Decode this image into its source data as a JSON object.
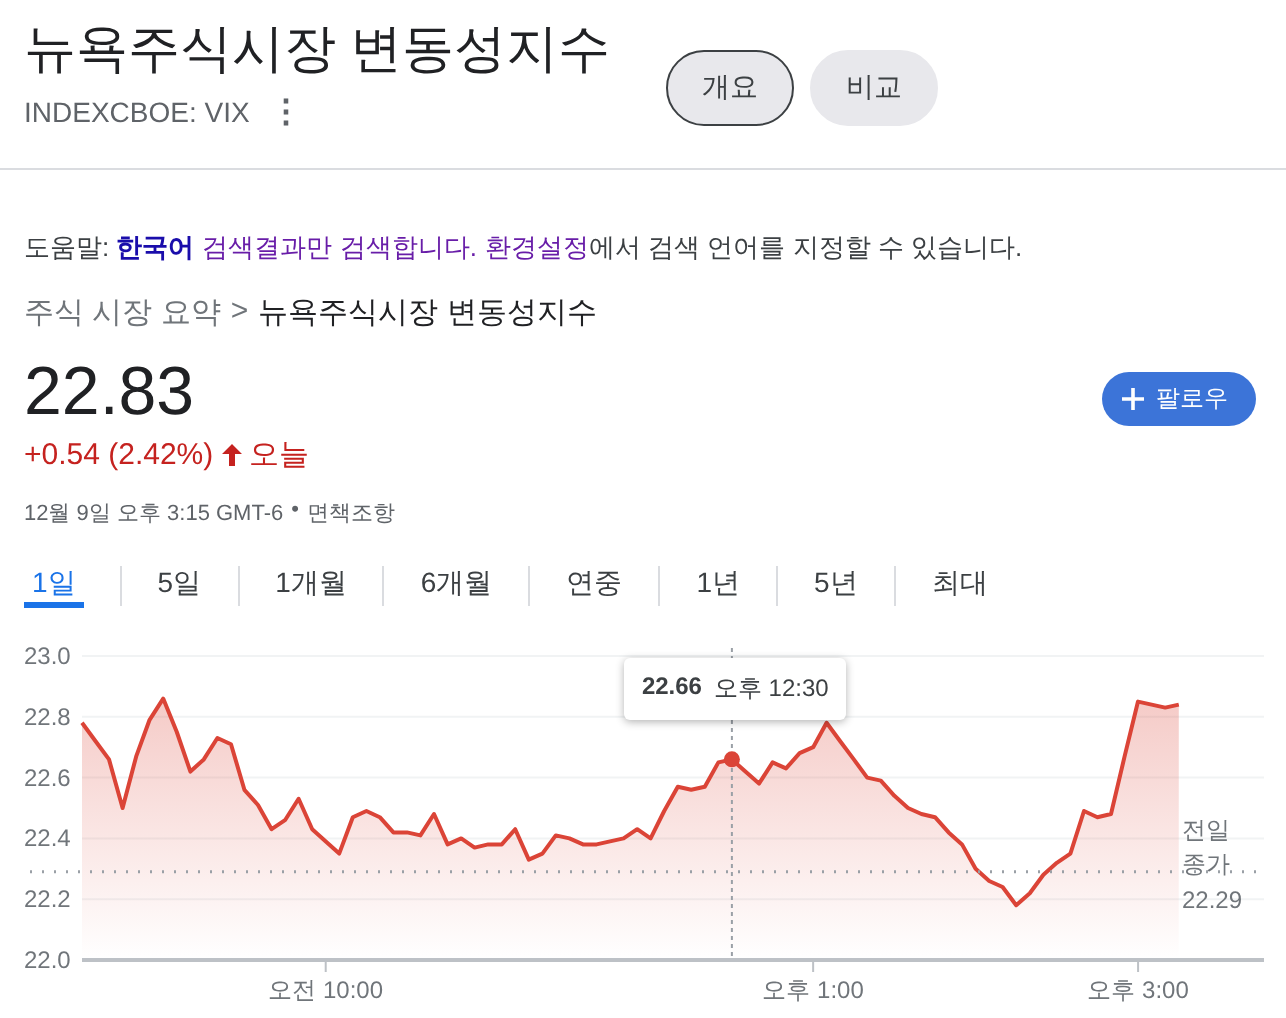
{
  "header": {
    "title": "뉴욕주식시장 변동성지수",
    "ticker": "INDEXCBOE: VIX",
    "menu_icon": "⋮",
    "buttons": [
      {
        "label": "개요",
        "selected": true
      },
      {
        "label": "비교",
        "selected": false
      }
    ]
  },
  "help": [
    {
      "text": "도움말: ",
      "kind": "plain"
    },
    {
      "text": "한국어",
      "kind": "strong-link"
    },
    {
      "text": "검색결과만 검색합니다.",
      "kind": "link"
    },
    {
      "text": "환경설정",
      "kind": "link"
    },
    {
      "text": "에서 검색 언어를 지정할 수 있습니다.",
      "kind": "plain"
    }
  ],
  "breadcrumb": {
    "parent": "주식 시장 요약",
    "separator": ">",
    "current": "뉴욕주식시장 변동성지수"
  },
  "quote": {
    "price": "22.83",
    "change": "+0.54 (2.42%)",
    "period": "오늘",
    "timestamp": "12월 9일 오후 3:15 GMT-6",
    "separator": "•",
    "disclaimer": "면책조항",
    "follow_button": "팔로우"
  },
  "tabs": [
    {
      "label": "1일",
      "selected": true
    },
    {
      "label": "5일",
      "selected": false
    },
    {
      "label": "1개월",
      "selected": false
    },
    {
      "label": "6개월",
      "selected": false
    },
    {
      "label": "연중",
      "selected": false
    },
    {
      "label": "1년",
      "selected": false
    },
    {
      "label": "5년",
      "selected": false
    },
    {
      "label": "최대",
      "selected": false
    }
  ],
  "chart": {
    "chart_data": {
      "type": "area",
      "categories": [
        null,
        null,
        null,
        null,
        null,
        null,
        null,
        null,
        null,
        null,
        null,
        null,
        null,
        null,
        null,
        null,
        null,
        null,
        "오전 10:00",
        null,
        null,
        null,
        null,
        null,
        null,
        null,
        null,
        null,
        null,
        null,
        null,
        null,
        null,
        null,
        null,
        null,
        null,
        null,
        null,
        null,
        null,
        null,
        null,
        null,
        null,
        null,
        null,
        null,
        null,
        null,
        null,
        null,
        null,
        null,
        "오후 1:00",
        null,
        null,
        null,
        null,
        null,
        null,
        null,
        null,
        null,
        null,
        null,
        null,
        null,
        null,
        null,
        null,
        null,
        null,
        null,
        null,
        null,
        null,
        null,
        "오후 3:00",
        null,
        null,
        null
      ],
      "series": [
        {
          "color": "#db4437",
          "values": [
            22.78,
            22.72,
            22.66,
            22.5,
            22.67,
            22.79,
            22.86,
            22.75,
            22.62,
            22.66,
            22.73,
            22.71,
            22.56,
            22.51,
            22.43,
            22.46,
            22.53,
            22.43,
            22.39,
            22.35,
            22.47,
            22.49,
            22.47,
            22.42,
            22.42,
            22.41,
            22.48,
            22.38,
            22.4,
            22.37,
            22.38,
            22.38,
            22.43,
            22.33,
            22.35,
            22.41,
            22.4,
            22.38,
            22.38,
            22.39,
            22.4,
            22.43,
            22.4,
            22.49,
            22.57,
            22.56,
            22.57,
            22.65,
            22.66,
            22.62,
            22.58,
            22.65,
            22.63,
            22.68,
            22.7,
            22.78,
            22.72,
            22.66,
            22.6,
            22.59,
            22.54,
            22.5,
            22.48,
            22.47,
            22.42,
            22.38,
            22.3,
            22.26,
            22.24,
            22.18,
            22.22,
            22.28,
            22.32,
            22.35,
            22.49,
            22.47,
            22.48,
            22.67,
            22.85,
            22.84,
            22.83,
            22.84
          ]
        }
      ],
      "ylim": [
        22.0,
        23.0
      ],
      "grid": true,
      "yticks": [
        {
          "value": 22.0,
          "label": "22.0"
        },
        {
          "value": 22.2,
          "label": "22.2"
        },
        {
          "value": 22.4,
          "label": "22.4"
        },
        {
          "value": 22.6,
          "label": "22.6"
        },
        {
          "value": 22.8,
          "label": "22.8"
        },
        {
          "value": 23.0,
          "label": "23.0"
        }
      ],
      "ref_lines": [
        {
          "axis": "y",
          "value": 22.29,
          "label": "22.29"
        }
      ]
    },
    "previous_close_label": "전일 종가",
    "tooltip": {
      "value": "22.66",
      "time": "오후 12:30",
      "level": 0.55
    }
  }
}
